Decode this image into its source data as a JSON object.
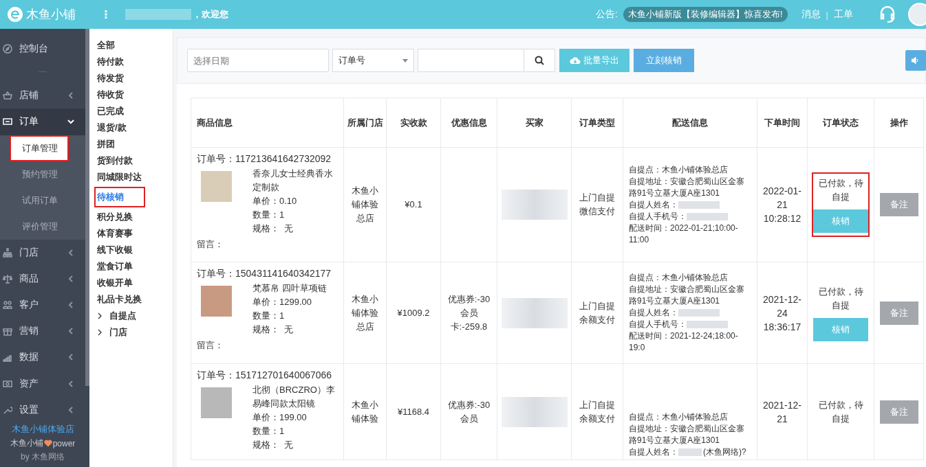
{
  "header": {
    "logo": "木鱼小铺",
    "welcome": "，欢迎您",
    "notice_label": "公告:",
    "notice": "木鱼小铺新版【装修编辑器】惊喜发布!",
    "links": [
      "消息",
      "工单"
    ],
    "separator": "|"
  },
  "sidebar": {
    "items": [
      {
        "label": "控制台",
        "kind": "link"
      },
      {
        "label": "店铺",
        "kind": "group",
        "expanded": false
      },
      {
        "label": "订单",
        "kind": "group",
        "expanded": true,
        "children": [
          {
            "label": "订单管理",
            "selected": true,
            "highlighted": true
          },
          {
            "label": "预约管理",
            "selected": false,
            "highlighted": false
          },
          {
            "label": "试用订单",
            "selected": false,
            "highlighted": false
          },
          {
            "label": "评价管理",
            "selected": false,
            "highlighted": false
          }
        ]
      },
      {
        "label": "门店",
        "kind": "group",
        "expanded": false
      },
      {
        "label": "商品",
        "kind": "group",
        "expanded": false
      },
      {
        "label": "客户",
        "kind": "group",
        "expanded": false
      },
      {
        "label": "营销",
        "kind": "group",
        "expanded": false
      },
      {
        "label": "数据",
        "kind": "group",
        "expanded": false
      },
      {
        "label": "资产",
        "kind": "group",
        "expanded": false
      },
      {
        "label": "设置",
        "kind": "group",
        "expanded": false
      }
    ],
    "footer": {
      "shop": "木鱼小铺体验店",
      "brand": "木鱼小铺",
      "power": "power",
      "by": "by 木鱼网络"
    }
  },
  "subnav": {
    "items": [
      {
        "label": "全部",
        "kind": "link",
        "selected": false,
        "highlighted": false
      },
      {
        "label": "待付款",
        "kind": "link",
        "selected": false,
        "highlighted": false
      },
      {
        "label": "待发货",
        "kind": "link",
        "selected": false,
        "highlighted": false
      },
      {
        "label": "待收货",
        "kind": "link",
        "selected": false,
        "highlighted": false
      },
      {
        "label": "已完成",
        "kind": "link",
        "selected": false,
        "highlighted": false
      },
      {
        "label": "退货/款",
        "kind": "link",
        "selected": false,
        "highlighted": false
      },
      {
        "label": "拼团",
        "kind": "link",
        "selected": false,
        "highlighted": false
      },
      {
        "label": "货到付款",
        "kind": "link",
        "selected": false,
        "highlighted": false
      },
      {
        "label": "同城限时达",
        "kind": "link",
        "selected": false,
        "highlighted": false
      },
      {
        "label": "待核销",
        "kind": "link",
        "selected": true,
        "highlighted": true
      },
      {
        "label": "积分兑换",
        "kind": "link",
        "selected": false,
        "highlighted": false
      },
      {
        "label": "体育赛事",
        "kind": "link",
        "selected": false,
        "highlighted": false
      },
      {
        "label": "线下收银",
        "kind": "link",
        "selected": false,
        "highlighted": false
      },
      {
        "label": "堂食订单",
        "kind": "link",
        "selected": false,
        "highlighted": false
      },
      {
        "label": "收银开单",
        "kind": "link",
        "selected": false,
        "highlighted": false
      },
      {
        "label": "礼品卡兑换",
        "kind": "link",
        "selected": false,
        "highlighted": false
      },
      {
        "label": "自提点",
        "kind": "folder",
        "expanded": false
      },
      {
        "label": "门店",
        "kind": "folder",
        "expanded": false
      }
    ]
  },
  "toolbar": {
    "date_placeholder": "选择日期",
    "search_by": "订单号",
    "export_button": "批量导出",
    "verify_button": "立刻核销"
  },
  "table": {
    "columns": [
      "商品信息",
      "所属门店",
      "实收款",
      "优惠信息",
      "买家",
      "订单类型",
      "配送信息",
      "下单时间",
      "订单状态",
      "操作"
    ],
    "rows": [
      {
        "order_label": "订单号：",
        "order_no": "117213641642732092",
        "product": "香奈儿女士经典香水定制款",
        "price": "单价：0.10",
        "qty": "数量：1",
        "spec": "规格：  无",
        "note": "留言：",
        "store": "木鱼小铺体验总店",
        "paid": "¥0.1",
        "discount": "",
        "type": "上门自提",
        "payment": "微信支付",
        "delivery": [
          {
            "text": "自提点：木鱼小铺体验总店",
            "redacted": false
          },
          {
            "text": "自提地址：安徽合肥蜀山区金寨路91号立基大厦A座1301",
            "redacted": false
          },
          {
            "text": "自提人姓名：",
            "redacted": true
          },
          {
            "text": "自提人手机号：",
            "redacted": true
          },
          {
            "text": "配送时间：2022-01-21;10:00-11:00",
            "redacted": false
          }
        ],
        "time": "2022-01-21 10:28:12",
        "status": "已付款，待自提",
        "status_highlighted": true,
        "verify": "核销",
        "remark": "备注"
      },
      {
        "order_label": "订单号：",
        "order_no": "150431141640342177",
        "product": "梵慕帛 四叶草项链",
        "price": "单价：1299.00",
        "qty": "数量：1",
        "spec": "规格：  无",
        "note": "留言：",
        "store": "木鱼小铺体验总店",
        "paid": "¥1009.2",
        "discount": "优惠券:-30 会员卡:-259.8",
        "type": "上门自提",
        "payment": "余额支付",
        "delivery": [
          {
            "text": "自提点：木鱼小铺体验总店",
            "redacted": false
          },
          {
            "text": "自提地址：安徽合肥蜀山区金寨路91号立基大厦A座1301",
            "redacted": false
          },
          {
            "text": "自提人姓名：",
            "redacted": true
          },
          {
            "text": "自提人手机号：",
            "redacted": true
          },
          {
            "text": "配送时间：2021-12-24;18:00-19:0",
            "redacted": false
          }
        ],
        "time": "2021-12-24 18:36:17",
        "status": "已付款，待自提",
        "status_highlighted": false,
        "verify": "核销",
        "remark": "备注"
      },
      {
        "order_label": "订单号：",
        "order_no": "151712701640067066",
        "product": "北彻（BRCZRO）李易峰同款太阳镜",
        "price": "单价：199.00",
        "qty": "数量：1",
        "spec": "规格：  无",
        "note": "",
        "store": "木鱼小铺体验",
        "paid": "¥1168.4",
        "discount": "优惠券:-30 会员",
        "type": "上门自提",
        "payment": "余额支付",
        "delivery": [
          {
            "text": "自提点：木鱼小铺体验总店",
            "redacted": false
          },
          {
            "text": "自提地址：安徽合肥蜀山区金寨路91号立基大厦A座1301",
            "redacted": false
          },
          {
            "text": "自提人姓名：",
            "redacted": true,
            "after": "(木鱼网络)?"
          }
        ],
        "time": "2021-12-21",
        "status": "已付款，待自提",
        "status_highlighted": false,
        "verify": "",
        "remark": "备注"
      }
    ]
  }
}
